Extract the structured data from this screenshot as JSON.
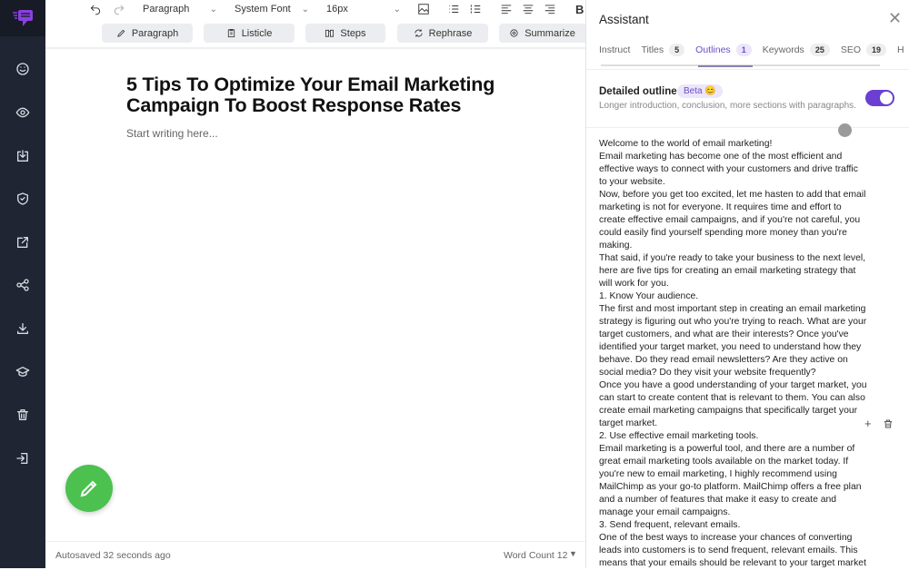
{
  "sidebar": {
    "icons": [
      "smile-icon",
      "eye-icon",
      "import-icon",
      "shield-check-icon",
      "external-link-icon",
      "share-icon",
      "download-icon",
      "graduation-cap-icon",
      "trash-icon",
      "logout-icon"
    ],
    "brand_color": "#8b3fe0"
  },
  "toolbar": {
    "block_type": "Paragraph",
    "font": "System Font",
    "size": "16px",
    "bold": "B"
  },
  "actions": [
    {
      "label": "Paragraph",
      "icon": "pencil-icon"
    },
    {
      "label": "Listicle",
      "icon": "clipboard-icon"
    },
    {
      "label": "Steps",
      "icon": "book-icon"
    },
    {
      "label": "Rephrase",
      "icon": "refresh-icon"
    },
    {
      "label": "Summarize",
      "icon": "gear-icon"
    }
  ],
  "editor": {
    "title": "5 Tips To Optimize Your Email Marketing Campaign To Boost Response Rates",
    "placeholder": "Start writing here...",
    "autosave": "Autosaved 32 seconds ago",
    "word_count": "Word Count 12"
  },
  "assistant": {
    "title": "Assistant",
    "tabs": [
      {
        "label": "Instruct"
      },
      {
        "label": "Titles",
        "count": "5"
      },
      {
        "label": "Outlines",
        "count": "1",
        "active": true
      },
      {
        "label": "Keywords",
        "count": "25"
      },
      {
        "label": "SEO",
        "count": "19"
      },
      {
        "label": "H"
      }
    ],
    "detailed_outline": {
      "label": "Detailed outline",
      "badge": "Beta 😊",
      "description": "Longer introduction, conclusion, more sections with paragraphs.",
      "enabled": true
    },
    "outline_lines": [
      "Welcome to the world of email marketing!",
      "Email marketing has become one of the most efficient and",
      "effective ways to connect with your customers and drive traffic",
      "to your website.",
      "Now, before you get too excited, let me hasten to add that email",
      "marketing is not for everyone. It requires time and effort to",
      "create effective email campaigns, and if you're not careful, you",
      "could easily find yourself spending more money than you're",
      "making.",
      "That said, if you're ready to take your business to the next level,",
      "here are five tips for creating an email marketing strategy that",
      "will work for you.",
      "1. Know Your audience.",
      "The first and most important step in creating an email marketing",
      "strategy is figuring out who you're trying to reach. What are your",
      "target customers, and what are their interests? Once you've",
      "identified your target market, you need to understand how they",
      "behave. Do they read email newsletters? Are they active on",
      "social media? Do they visit your website frequently?",
      "Once you have a good understanding of your target market, you",
      "can start to create content that is relevant to them. You can also",
      "create email marketing campaigns that specifically target your",
      "target market.",
      "2. Use effective email marketing tools.",
      "Email marketing is a powerful tool, and there are a number of",
      "great email marketing tools available on the market today. If",
      "you're new to email marketing, I highly recommend using",
      "MailChimp as your go-to platform. MailChimp offers a free plan",
      "and a number of features that make it easy to create and",
      "manage your email campaigns.",
      "3. Send frequent, relevant emails.",
      "One of the best ways to increase your chances of converting",
      "leads into customers is to send frequent, relevant emails. This",
      "means that your emails should be relevant to your target market"
    ]
  }
}
